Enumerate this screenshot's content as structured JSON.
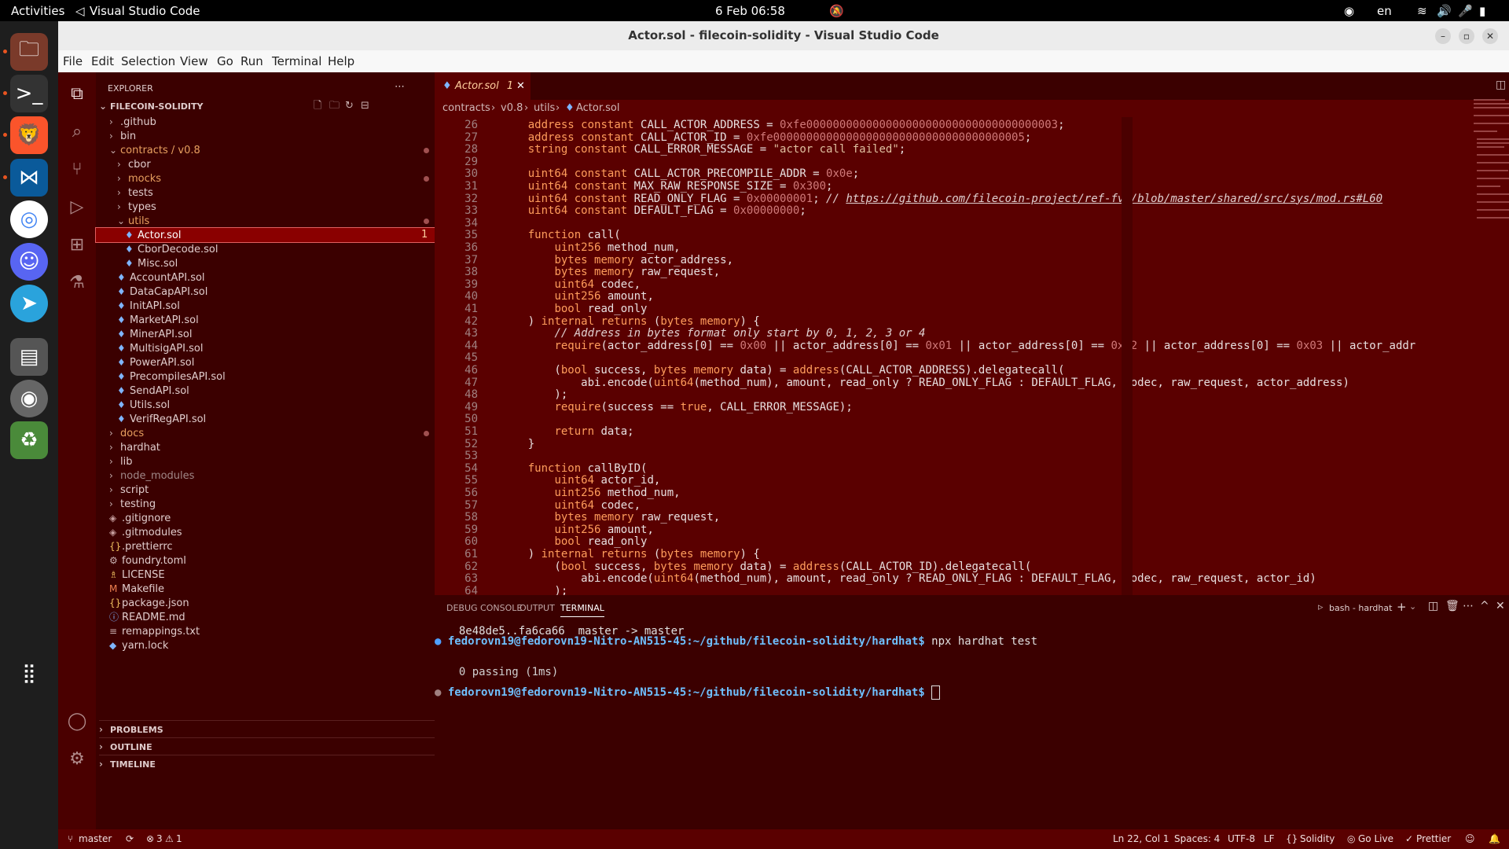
{
  "topbar": {
    "activities": "Activities",
    "app": "Visual Studio Code",
    "clock": "6 Feb  06:58",
    "lang": "en"
  },
  "window": {
    "title": "Actor.sol - filecoin-solidity - Visual Studio Code"
  },
  "menu": [
    "File",
    "Edit",
    "Selection",
    "View",
    "Go",
    "Run",
    "Terminal",
    "Help"
  ],
  "explorer": {
    "header": "EXPLORER",
    "root": "FILECOIN-SOLIDITY",
    "items": [
      {
        "label": ".github",
        "type": "folder",
        "indent": 1
      },
      {
        "label": "bin",
        "type": "folder",
        "indent": 1
      },
      {
        "label": "contracts / v0.8",
        "type": "folder-open",
        "indent": 1,
        "modified": true
      },
      {
        "label": "cbor",
        "type": "folder",
        "indent": 2
      },
      {
        "label": "mocks",
        "type": "folder",
        "indent": 2,
        "modified": true
      },
      {
        "label": "tests",
        "type": "folder",
        "indent": 2
      },
      {
        "label": "types",
        "type": "folder",
        "indent": 2
      },
      {
        "label": "utils",
        "type": "folder-open",
        "indent": 2,
        "modified": true
      },
      {
        "label": "Actor.sol",
        "type": "sol",
        "indent": 3,
        "selected": true,
        "badge": "1"
      },
      {
        "label": "CborDecode.sol",
        "type": "sol",
        "indent": 3
      },
      {
        "label": "Misc.sol",
        "type": "sol",
        "indent": 3
      },
      {
        "label": "AccountAPI.sol",
        "type": "sol",
        "indent": 2
      },
      {
        "label": "DataCapAPI.sol",
        "type": "sol",
        "indent": 2
      },
      {
        "label": "InitAPI.sol",
        "type": "sol",
        "indent": 2
      },
      {
        "label": "MarketAPI.sol",
        "type": "sol",
        "indent": 2
      },
      {
        "label": "MinerAPI.sol",
        "type": "sol",
        "indent": 2
      },
      {
        "label": "MultisigAPI.sol",
        "type": "sol",
        "indent": 2
      },
      {
        "label": "PowerAPI.sol",
        "type": "sol",
        "indent": 2
      },
      {
        "label": "PrecompilesAPI.sol",
        "type": "sol",
        "indent": 2
      },
      {
        "label": "SendAPI.sol",
        "type": "sol",
        "indent": 2
      },
      {
        "label": "Utils.sol",
        "type": "sol",
        "indent": 2
      },
      {
        "label": "VerifRegAPI.sol",
        "type": "sol",
        "indent": 2
      },
      {
        "label": "docs",
        "type": "folder",
        "indent": 1,
        "modified": true
      },
      {
        "label": "hardhat",
        "type": "folder",
        "indent": 1
      },
      {
        "label": "lib",
        "type": "folder",
        "indent": 1
      },
      {
        "label": "node_modules",
        "type": "folder",
        "indent": 1,
        "dim": true
      },
      {
        "label": "script",
        "type": "folder",
        "indent": 1
      },
      {
        "label": "testing",
        "type": "folder",
        "indent": 1
      },
      {
        "label": ".gitignore",
        "type": "git",
        "indent": 1
      },
      {
        "label": ".gitmodules",
        "type": "git",
        "indent": 1
      },
      {
        "label": ".prettierrc",
        "type": "json",
        "indent": 1
      },
      {
        "label": "foundry.toml",
        "type": "gear",
        "indent": 1
      },
      {
        "label": "LICENSE",
        "type": "license",
        "indent": 1
      },
      {
        "label": "Makefile",
        "type": "make",
        "indent": 1
      },
      {
        "label": "package.json",
        "type": "json",
        "indent": 1
      },
      {
        "label": "README.md",
        "type": "info",
        "indent": 1
      },
      {
        "label": "remappings.txt",
        "type": "txt",
        "indent": 1
      },
      {
        "label": "yarn.lock",
        "type": "yarn",
        "indent": 1
      }
    ],
    "sections": [
      "PROBLEMS",
      "OUTLINE",
      "TIMELINE"
    ]
  },
  "tab": {
    "label": "Actor.sol",
    "badge": "1"
  },
  "breadcrumb": [
    "contracts",
    "v0.8",
    "utils",
    "Actor.sol"
  ],
  "code_start_line": 26,
  "code": [
    "    address constant CALL_ACTOR_ADDRESS = 0xfe00000000000000000000000000000000000003;",
    "    address constant CALL_ACTOR_ID = 0xfe00000000000000000000000000000000000005;",
    "    string constant CALL_ERROR_MESSAGE = \"actor call failed\";",
    "",
    "    uint64 constant CALL_ACTOR_PRECOMPILE_ADDR = 0x0e;",
    "    uint64 constant MAX_RAW_RESPONSE_SIZE = 0x300;",
    "    uint64 constant READ_ONLY_FLAG = 0x00000001; // https://github.com/filecoin-project/ref-fvm/blob/master/shared/src/sys/mod.rs#L60",
    "    uint64 constant DEFAULT_FLAG = 0x00000000;",
    "",
    "    function call(",
    "        uint256 method_num,",
    "        bytes memory actor_address,",
    "        bytes memory raw_request,",
    "        uint64 codec,",
    "        uint256 amount,",
    "        bool read_only",
    "    ) internal returns (bytes memory) {",
    "        // Address in bytes format only start by 0, 1, 2, 3 or 4",
    "        require(actor_address[0] == 0x00 || actor_address[0] == 0x01 || actor_address[0] == 0x02 || actor_address[0] == 0x03 || actor_addr",
    "",
    "        (bool success, bytes memory data) = address(CALL_ACTOR_ADDRESS).delegatecall(",
    "            abi.encode(uint64(method_num), amount, read_only ? READ_ONLY_FLAG : DEFAULT_FLAG, codec, raw_request, actor_address)",
    "        );",
    "        require(success == true, CALL_ERROR_MESSAGE);",
    "",
    "        return data;",
    "    }",
    "",
    "    function callByID(",
    "        uint64 actor_id,",
    "        uint256 method_num,",
    "        uint64 codec,",
    "        bytes memory raw_request,",
    "        uint256 amount,",
    "        bool read_only",
    "    ) internal returns (bytes memory) {",
    "        (bool success, bytes memory data) = address(CALL_ACTOR_ID).delegatecall(",
    "            abi.encode(uint64(method_num), amount, read_only ? READ_ONLY_FLAG : DEFAULT_FLAG, codec, raw_request, actor_id)",
    "        );"
  ],
  "panel": {
    "tabs": [
      "DEBUG CONSOLE",
      "OUTPUT",
      "TERMINAL"
    ],
    "active_tab": "TERMINAL",
    "terminal_name": "bash - hardhat",
    "lines": [
      "  8e48de5..fa6ca66  master -> master",
      "fedorovn19@fedorovn19-Nitro-AN515-45:~/github/filecoin-solidity/hardhat$ npx hardhat test",
      "",
      "",
      "  0 passing (1ms)",
      "",
      "fedorovn19@fedorovn19-Nitro-AN515-45:~/github/filecoin-solidity/hardhat$ "
    ]
  },
  "status": {
    "branch": "master",
    "errors": "3",
    "warnings": "1",
    "position": "Ln 22, Col 1",
    "spaces": "Spaces: 4",
    "encoding": "UTF-8",
    "eol": "LF",
    "language": "Solidity",
    "golive": "Go Live",
    "prettier": "Prettier"
  },
  "colors": {
    "accent": "#ff9d5c",
    "bg": "#5a0000",
    "sidebar": "#3b0000",
    "selected": "#8a0000"
  }
}
